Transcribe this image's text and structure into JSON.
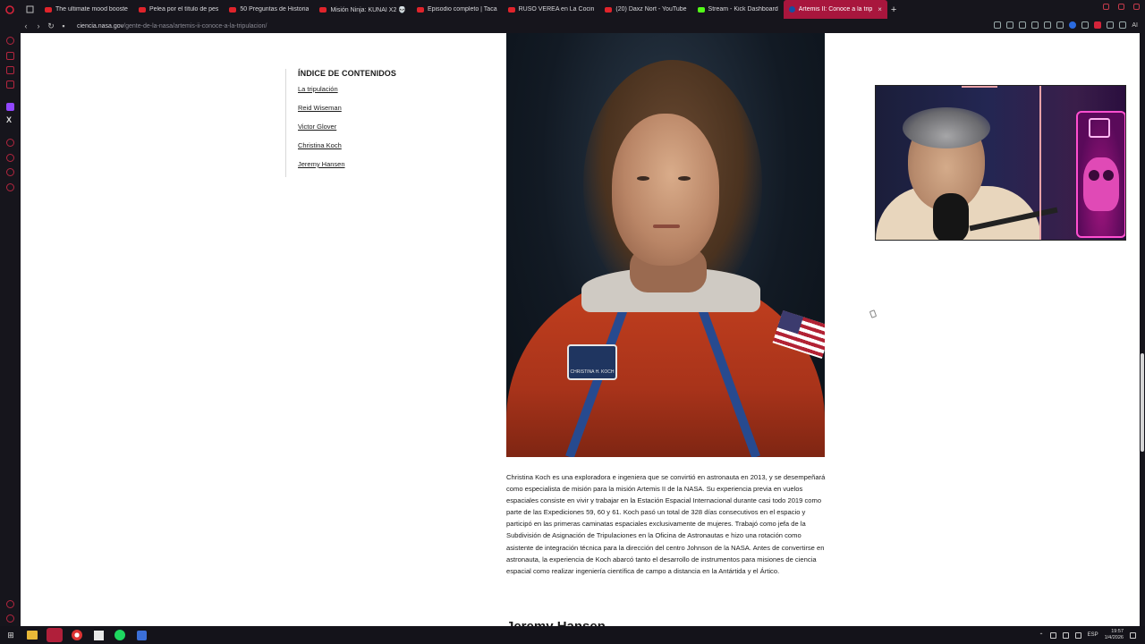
{
  "browser": {
    "tabs": [
      {
        "label": "The ultimate mood booste",
        "icon": "youtube-icon"
      },
      {
        "label": "Pelea por el título de pes",
        "icon": "youtube-icon"
      },
      {
        "label": "50 Preguntas de Historia",
        "icon": "youtube-icon"
      },
      {
        "label": "Misión Ninja: KUNAI X2 💀",
        "icon": "youtube-icon"
      },
      {
        "label": "Episodio completo | Taca",
        "icon": "youtube-icon"
      },
      {
        "label": "RUSO VEREA en La Cocin",
        "icon": "youtube-icon"
      },
      {
        "label": "(20) Daxz Nort - YouTube",
        "icon": "youtube-icon"
      },
      {
        "label": "Stream - Kick Dashboard",
        "icon": "kick-icon"
      },
      {
        "label": "Artemis II: Conoce a la trip",
        "icon": "nasa-icon",
        "active": true
      }
    ],
    "url_domain": "ciencia.nasa.gov",
    "url_path": "/gente-de-la-nasa/artemis-ii-conoce-a-la-tripulacion/",
    "ai_label": "AI"
  },
  "toc": {
    "heading": "ÍNDICE DE CONTENIDOS",
    "items": [
      "La tripulación",
      "Reid Wiseman",
      "Victor Glover",
      "Christina Koch",
      "Jeremy Hansen"
    ]
  },
  "photo": {
    "patch_text": "CHRISTINA H. KOCH"
  },
  "bio": {
    "text": "Christina Koch es una exploradora e ingeniera que se convirtió en astronauta en 2013, y se desempeñará como especialista de misión para la misión Artemis II de la NASA. Su experiencia previa en vuelos espaciales consiste en vivir y trabajar en la Estación Espacial Internacional durante casi todo 2019 como parte de las Expediciones 59, 60 y 61. Koch pasó un total de 328 días consecutivos en el espacio y participó en las primeras caminatas espaciales exclusivamente de mujeres. Trabajó como jefa de la Subdivisión de Asignación de Tripulaciones en la Oficina de Astronautas e hizo una rotación como asistente de integración técnica para la dirección del centro Johnson de la NASA. Antes de convertirse en astronauta, la experiencia de Koch abarcó tanto el desarrollo de instrumentos para misiones de ciencia espacial como realizar ingeniería científica de campo a distancia en la Antártida y el Ártico."
  },
  "next_section": "Jeremy Hansen",
  "taskbar": {
    "language": "ESP",
    "time": "19:57",
    "date": "1/4/2026"
  }
}
